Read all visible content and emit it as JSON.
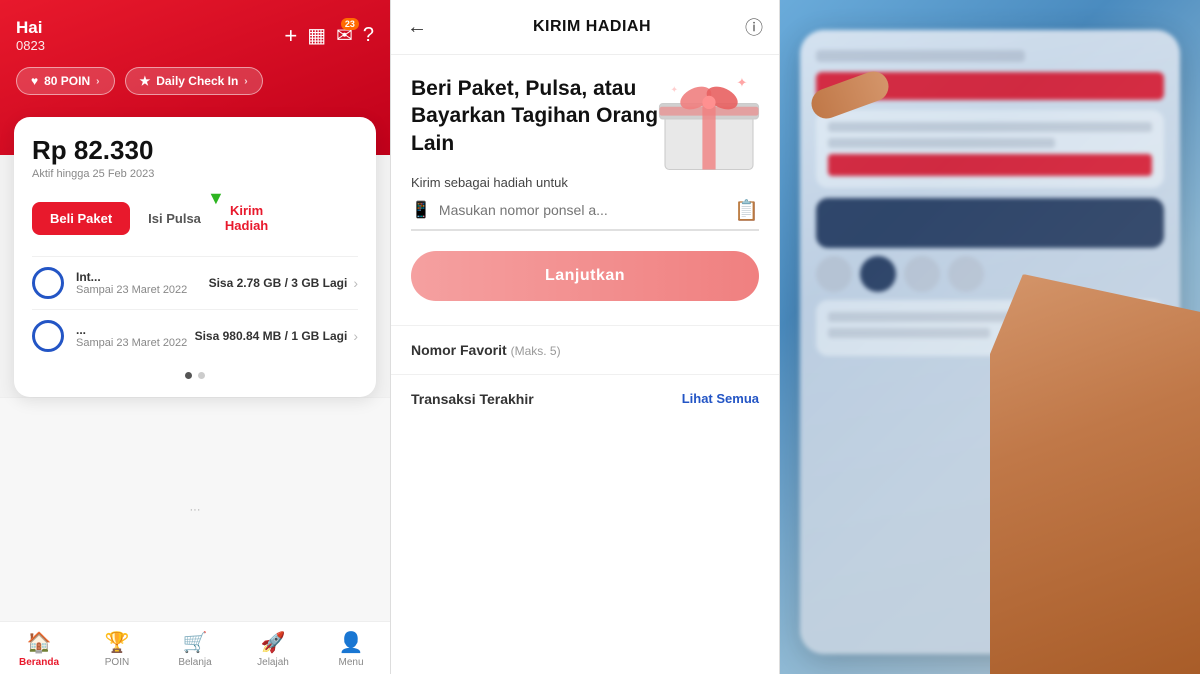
{
  "left_phone": {
    "greeting": "Hai",
    "phone_number": "0823",
    "points_label": "80 POIN",
    "daily_checkin_label": "Daily Check In",
    "balance": "Rp 82.330",
    "expiry": "Aktif hingga 25 Feb 2023",
    "beli_label": "Beli Paket",
    "isi_label": "Isi Pulsa",
    "kirim_label": "Kirim\nHadiah",
    "data_rows": [
      {
        "name": "Int...",
        "detail": "Sisa 2.78 GB / 3 GB Lagi",
        "until": "Sampai 23 Maret 2022"
      },
      {
        "name": "...",
        "detail": "Sisa 980.84 MB / 1 GB Lagi",
        "until": "Sampai 23 Maret 2022"
      }
    ],
    "nav_items": [
      {
        "icon": "🏠",
        "label": "Beranda",
        "active": true
      },
      {
        "icon": "🏆",
        "label": "POIN",
        "active": false
      },
      {
        "icon": "🛒",
        "label": "Belanja",
        "active": false
      },
      {
        "icon": "🚀",
        "label": "Jelajah",
        "active": false
      },
      {
        "icon": "👤",
        "label": "Menu",
        "active": false
      }
    ],
    "notification_count": "23"
  },
  "middle_phone": {
    "title": "KIRIM HADIAH",
    "hero_title": "Beri Paket, Pulsa, atau Bayarkan\nTagihan Orang Lain",
    "send_label": "Kirim sebagai hadiah untuk",
    "input_placeholder": "Masukan nomor ponsel a...",
    "lanjutkan_label": "Lanjutkan",
    "nomor_favorit_label": "Nomor Favorit",
    "maks_label": "(Maks. 5)",
    "transaksi_label": "Transaksi Terakhir",
    "lihat_semua_label": "Lihat Semua"
  }
}
